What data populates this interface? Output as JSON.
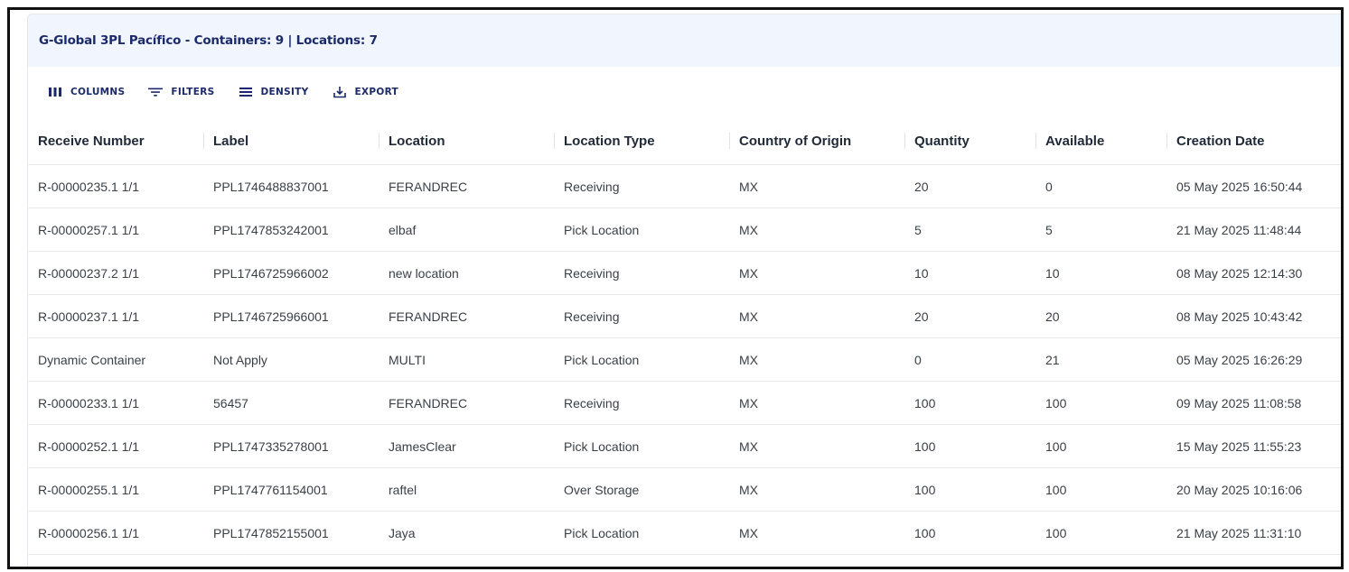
{
  "header": {
    "title": "G-Global 3PL Pacífico - Containers: 9 | Locations: 7"
  },
  "toolbar": {
    "columns": {
      "label": "COLUMNS",
      "icon": "columns-icon"
    },
    "filters": {
      "label": "FILTERS",
      "icon": "filter-icon"
    },
    "density": {
      "label": "DENSITY",
      "icon": "density-icon"
    },
    "export": {
      "label": "EXPORT",
      "icon": "export-icon"
    }
  },
  "colors": {
    "header_bg": "#f1f5fd",
    "accent": "#1b2a6b"
  },
  "table": {
    "columns": [
      "Receive Number",
      "Label",
      "Location",
      "Location Type",
      "Country of Origin",
      "Quantity",
      "Available",
      "Creation Date"
    ],
    "rows": [
      [
        "R-00000235.1 1/1",
        "PPL1746488837001",
        "FERANDREC",
        "Receiving",
        "MX",
        "20",
        "0",
        "05 May 2025 16:50:44"
      ],
      [
        "R-00000257.1 1/1",
        "PPL1747853242001",
        "elbaf",
        "Pick Location",
        "MX",
        "5",
        "5",
        "21 May 2025 11:48:44"
      ],
      [
        "R-00000237.2 1/1",
        "PPL1746725966002",
        "new location",
        "Receiving",
        "MX",
        "10",
        "10",
        "08 May 2025 12:14:30"
      ],
      [
        "R-00000237.1 1/1",
        "PPL1746725966001",
        "FERANDREC",
        "Receiving",
        "MX",
        "20",
        "20",
        "08 May 2025 10:43:42"
      ],
      [
        "Dynamic Container",
        "Not Apply",
        "MULTI",
        "Pick Location",
        "MX",
        "0",
        "21",
        "05 May 2025 16:26:29"
      ],
      [
        "R-00000233.1 1/1",
        "56457",
        "FERANDREC",
        "Receiving",
        "MX",
        "100",
        "100",
        "09 May 2025 11:08:58"
      ],
      [
        "R-00000252.1 1/1",
        "PPL1747335278001",
        "JamesClear",
        "Pick Location",
        "MX",
        "100",
        "100",
        "15 May 2025 11:55:23"
      ],
      [
        "R-00000255.1 1/1",
        "PPL1747761154001",
        "raftel",
        "Over Storage",
        "MX",
        "100",
        "100",
        "20 May 2025 10:16:06"
      ],
      [
        "R-00000256.1 1/1",
        "PPL1747852155001",
        "Jaya",
        "Pick Location",
        "MX",
        "100",
        "100",
        "21 May 2025 11:31:10"
      ]
    ]
  }
}
